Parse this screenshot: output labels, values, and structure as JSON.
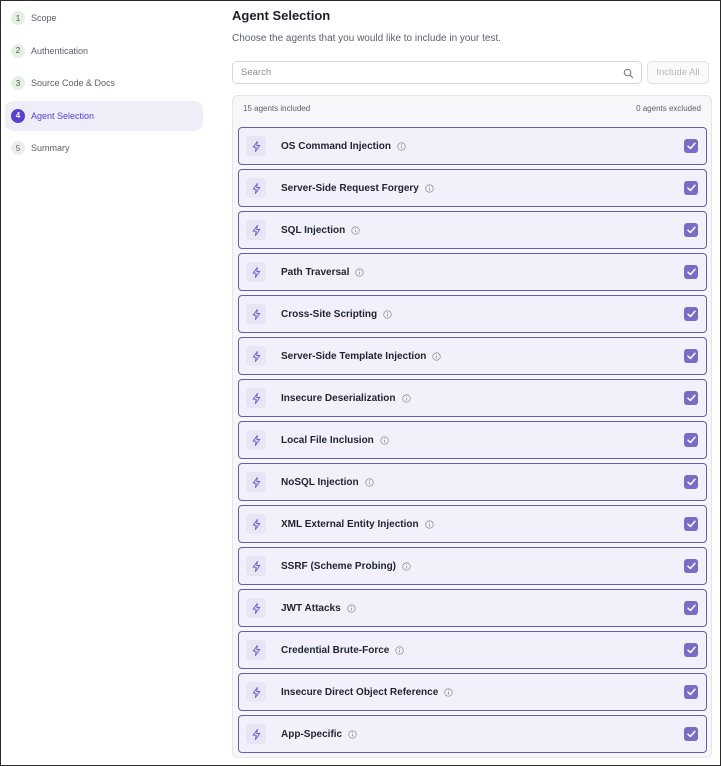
{
  "sidebar": {
    "steps": [
      {
        "number": "1",
        "label": "Scope",
        "state": "complete"
      },
      {
        "number": "2",
        "label": "Authentication",
        "state": "complete"
      },
      {
        "number": "3",
        "label": "Source Code & Docs",
        "state": "complete"
      },
      {
        "number": "4",
        "label": "Agent Selection",
        "state": "active"
      },
      {
        "number": "5",
        "label": "Summary",
        "state": "pending"
      }
    ]
  },
  "main": {
    "title": "Agent Selection",
    "subtitle": "Choose the agents that you would like to include in your test.",
    "search": {
      "placeholder": "Search",
      "value": ""
    },
    "include_all_label": "Include All",
    "included_text": "15 agents included",
    "excluded_text": "0 agents excluded",
    "agents": [
      {
        "name": "OS Command Injection",
        "checked": true
      },
      {
        "name": "Server-Side Request Forgery",
        "checked": true
      },
      {
        "name": "SQL Injection",
        "checked": true
      },
      {
        "name": "Path Traversal",
        "checked": true
      },
      {
        "name": "Cross-Site Scripting",
        "checked": true
      },
      {
        "name": "Server-Side Template Injection",
        "checked": true
      },
      {
        "name": "Insecure Deserialization",
        "checked": true
      },
      {
        "name": "Local File Inclusion",
        "checked": true
      },
      {
        "name": "NoSQL Injection",
        "checked": true
      },
      {
        "name": "XML External Entity Injection",
        "checked": true
      },
      {
        "name": "SSRF (Scheme Probing)",
        "checked": true
      },
      {
        "name": "JWT Attacks",
        "checked": true
      },
      {
        "name": "Credential Brute-Force",
        "checked": true
      },
      {
        "name": "Insecure Direct Object Reference",
        "checked": true
      },
      {
        "name": "App-Specific",
        "checked": true
      }
    ]
  },
  "colors": {
    "accent": "#5b3fcf",
    "agent_bg": "#f1f0fb",
    "agent_border": "#6a5ca8",
    "checkbox": "#7a6bc4"
  },
  "icons": {
    "agent": "bolt-icon",
    "info": "info-icon",
    "check": "check-icon",
    "search": "search-icon"
  }
}
